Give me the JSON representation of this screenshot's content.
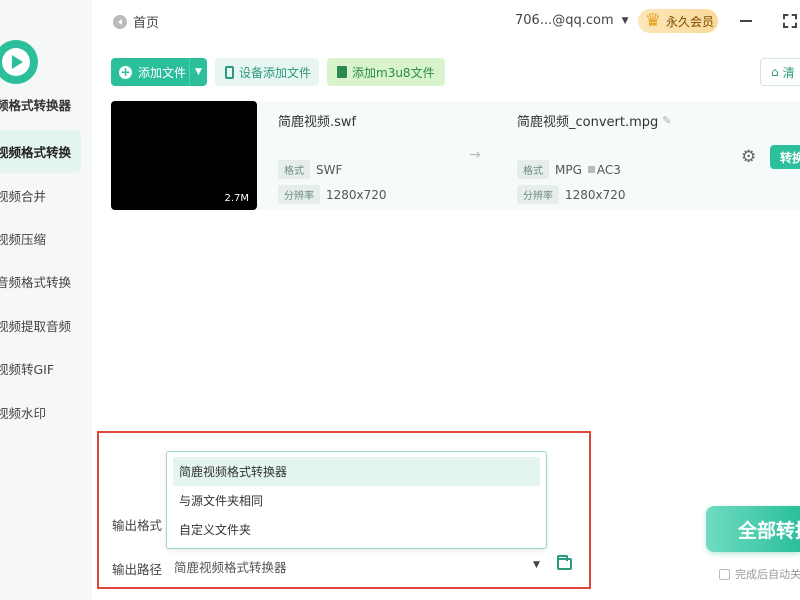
{
  "header": {
    "home_label": "首页",
    "account": "706...@qq.com",
    "vip_label": "永久会员"
  },
  "sidebar": {
    "app_name": "频格式转换器",
    "items": [
      {
        "label": "视频格式转换",
        "active": true
      },
      {
        "label": "视频合并",
        "active": false
      },
      {
        "label": "视频压缩",
        "active": false
      },
      {
        "label": "音频格式转换",
        "active": false
      },
      {
        "label": "视频提取音频",
        "active": false
      },
      {
        "label": "视频转GIF",
        "active": false
      },
      {
        "label": "视频水印",
        "active": false
      }
    ]
  },
  "toolbar": {
    "add_file": "添加文件",
    "device_add": "设备添加文件",
    "add_m3u8": "添加m3u8文件",
    "clear": "清"
  },
  "file": {
    "thumb_size": "2.7M",
    "source_name": "简鹿视频.swf",
    "source_format_tag": "格式",
    "source_format": "SWF",
    "source_res_tag": "分辨率",
    "source_res": "1280x720",
    "output_name": "简鹿视频_convert.mpg",
    "output_format_tag": "格式",
    "output_format": "MPG",
    "output_audio": "AC3",
    "output_res_tag": "分辨率",
    "output_res": "1280x720",
    "convert_label": "转换"
  },
  "output": {
    "format_label": "输出格式",
    "path_label": "输出路径",
    "path_value": "简鹿视频格式转换器",
    "options": [
      "简鹿视频格式转换器",
      "与源文件夹相同",
      "自定义文件夹"
    ],
    "selected_option": 0,
    "convert_all": "全部转换",
    "auto_label": "完成后自动关机"
  },
  "colors": {
    "accent": "#2bbf9c",
    "highlight": "#e2453c"
  }
}
